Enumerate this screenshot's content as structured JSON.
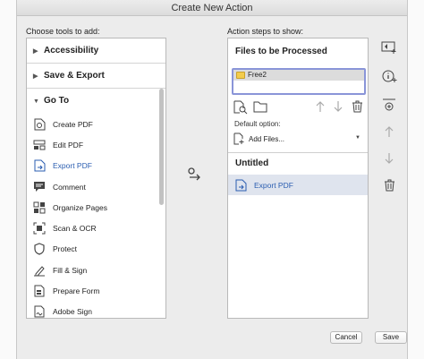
{
  "window": {
    "title": "Create New Action"
  },
  "left_panel": {
    "label": "Choose tools to add:",
    "categories": [
      {
        "label": "Accessibility",
        "expanded": false
      },
      {
        "label": "Save & Export",
        "expanded": false
      },
      {
        "label": "Go To",
        "expanded": true
      }
    ],
    "tools": [
      {
        "label": "Create PDF",
        "icon": "create-pdf-icon"
      },
      {
        "label": "Edit PDF",
        "icon": "edit-pdf-icon"
      },
      {
        "label": "Export PDF",
        "icon": "export-pdf-icon",
        "selected": true
      },
      {
        "label": "Comment",
        "icon": "comment-icon"
      },
      {
        "label": "Organize Pages",
        "icon": "organize-pages-icon"
      },
      {
        "label": "Scan & OCR",
        "icon": "scan-icon"
      },
      {
        "label": "Protect",
        "icon": "shield-icon"
      },
      {
        "label": "Fill & Sign",
        "icon": "pen-icon"
      },
      {
        "label": "Prepare Form",
        "icon": "form-icon"
      },
      {
        "label": "Adobe Sign",
        "icon": "sign-icon"
      }
    ]
  },
  "right_panel": {
    "label": "Action steps to show:",
    "files_header": "Files to be Processed",
    "files": [
      {
        "name": "Free2"
      }
    ],
    "default_option_label": "Default option:",
    "default_option_value": "Add Files...",
    "section_title": "Untitled",
    "steps": [
      {
        "label": "Export PDF",
        "icon": "export-pdf-icon"
      }
    ]
  },
  "buttons": {
    "cancel": "Cancel",
    "save": "Save"
  },
  "colors": {
    "accent": "#2a5db0",
    "selection_border": "#8a95d8",
    "step_highlight": "#dfe4ee"
  }
}
